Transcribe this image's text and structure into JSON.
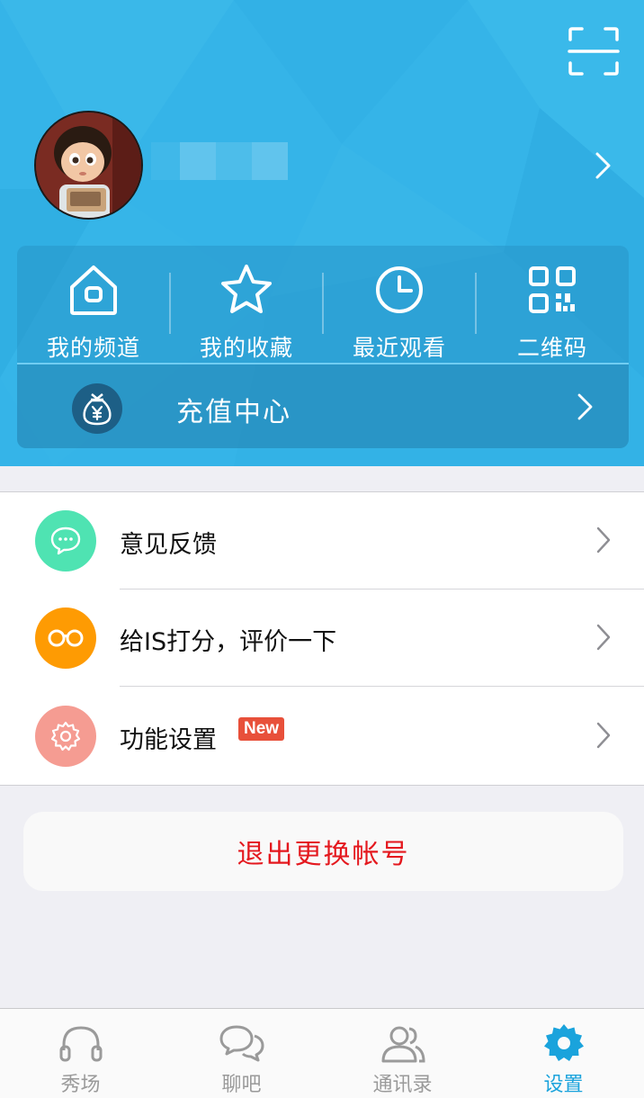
{
  "colors": {
    "header_blue": "#35b4e8",
    "feedback_green": "#4fe3b2",
    "rate_orange": "#fe9b03",
    "settings_salmon": "#f59c92",
    "logout_red": "#e4181e",
    "tab_active": "#1aa3dc",
    "new_badge": "#e8503a"
  },
  "header": {
    "scan_icon": "scan-icon",
    "avatar_icon": "avatar",
    "profile_chevron_icon": "chevron-right-icon"
  },
  "quick_actions": [
    {
      "label": "我的频道",
      "icon": "home-icon"
    },
    {
      "label": "我的收藏",
      "icon": "star-icon"
    },
    {
      "label": "最近观看",
      "icon": "clock-icon"
    },
    {
      "label": "二维码",
      "icon": "qr-code-icon"
    }
  ],
  "recharge": {
    "label": "充值中心",
    "icon": "money-bag-icon"
  },
  "settings_list": [
    {
      "label": "意见反馈",
      "icon": "chat-bubble-icon"
    },
    {
      "label": "给IS打分，评价一下",
      "icon": "glasses-icon"
    },
    {
      "label": "功能设置",
      "icon": "gear-icon",
      "badge": "New"
    }
  ],
  "logout": {
    "label": "退出更换帐号"
  },
  "tabbar": {
    "active_index": 3,
    "tabs": [
      {
        "label": "秀场",
        "icon": "headset-icon"
      },
      {
        "label": "聊吧",
        "icon": "chat-bubbles-icon"
      },
      {
        "label": "通讯录",
        "icon": "contacts-icon"
      },
      {
        "label": "设置",
        "icon": "gear-icon"
      }
    ]
  }
}
